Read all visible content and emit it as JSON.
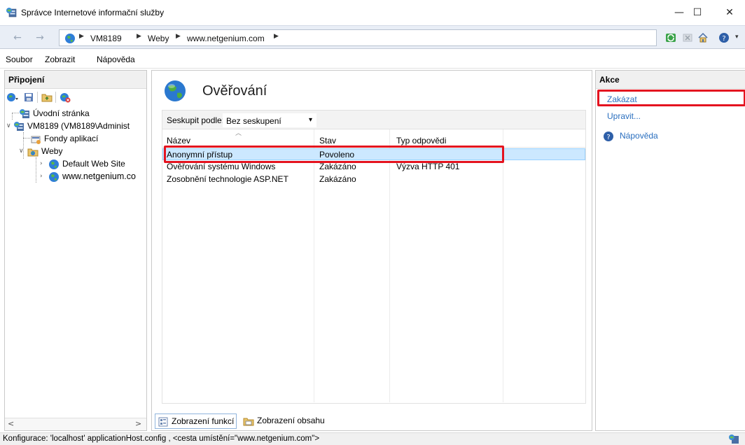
{
  "window": {
    "title": "Správce Internetové informační služby"
  },
  "address": {
    "crumbs": [
      "VM8189",
      "Weby",
      "www.netgenium.com"
    ]
  },
  "menu": [
    "Soubor",
    "Zobrazit",
    "Nápověda"
  ],
  "connections": {
    "header": "Připojení",
    "tree": {
      "start_page": "Úvodní stránka",
      "server": "VM8189 (VM8189\\Administ",
      "app_pools": "Fondy aplikací",
      "sites": "Weby",
      "default_site": "Default Web Site",
      "netgenium_site": "www.netgenium.co"
    }
  },
  "main": {
    "title": "Ověřování",
    "group_by_label": "Seskupit podle:",
    "group_by_value": "Bez seskupení",
    "columns": [
      "Název",
      "Stav",
      "Typ odpovědi"
    ],
    "rows": [
      {
        "name": "Anonymní přístup",
        "status": "Povoleno",
        "response": ""
      },
      {
        "name": "Ověřování systému Windows",
        "status": "Zakázáno",
        "response": "Výzva HTTP 401"
      },
      {
        "name": "Zosobnění technologie ASP.NET",
        "status": "Zakázáno",
        "response": ""
      }
    ],
    "tabs": {
      "features": "Zobrazení funkcí",
      "content": "Zobrazení obsahu"
    }
  },
  "actions": {
    "header": "Akce",
    "disable": "Zakázat",
    "edit": "Upravit...",
    "help": "Nápověda"
  },
  "status": {
    "text": "Konfigurace: 'localhost' applicationHost.config , <cesta umístění=\"www.netgenium.com\">"
  },
  "colors": {
    "highlight": "#e4131f",
    "link": "#2a6fbf",
    "selection": "#cce8ff"
  }
}
